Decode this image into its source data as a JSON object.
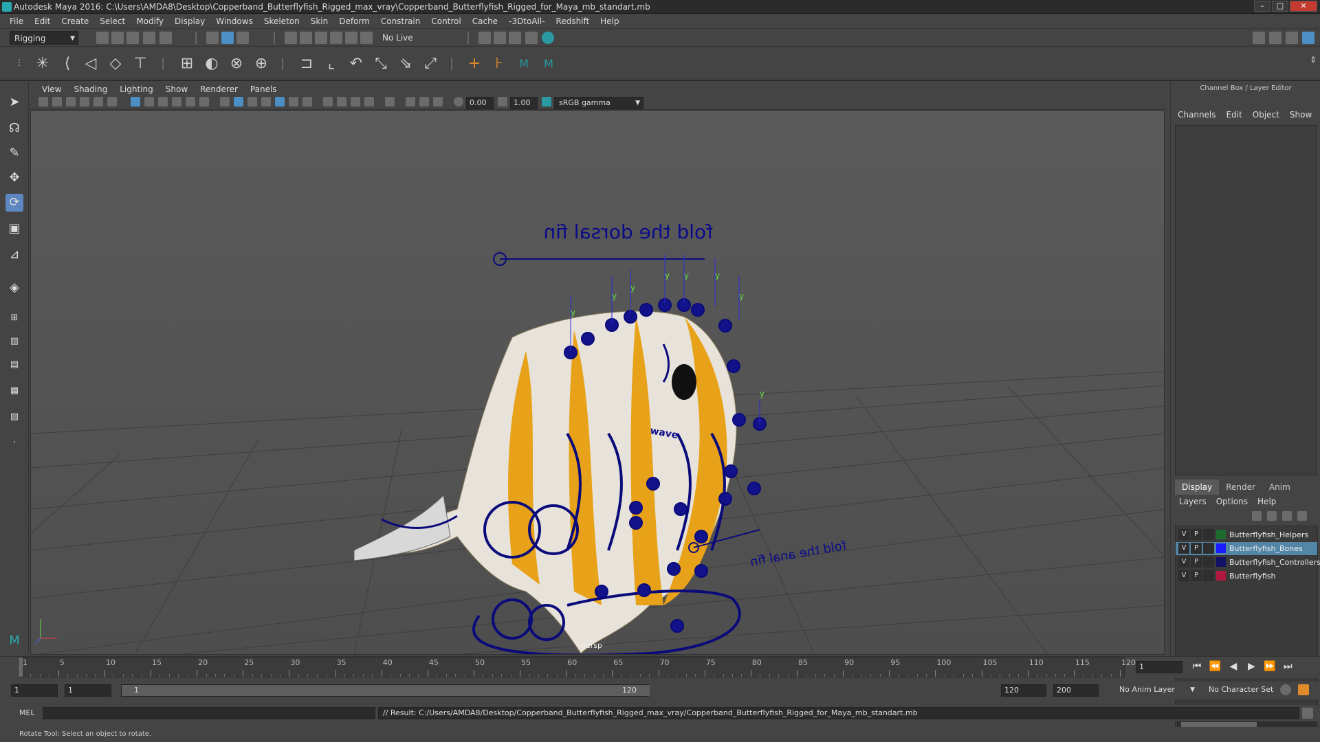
{
  "window": {
    "title": "Autodesk Maya 2016: C:\\Users\\AMDA8\\Desktop\\Copperband_Butterflyfish_Rigged_max_vray\\Copperband_Butterflyfish_Rigged_for_Maya_mb_standart.mb",
    "minimize": "–",
    "restore": "□",
    "close": "✕"
  },
  "menubar": {
    "items": [
      "File",
      "Edit",
      "Create",
      "Select",
      "Modify",
      "Display",
      "Windows",
      "Skeleton",
      "Skin",
      "Deform",
      "Constrain",
      "Control",
      "Cache",
      "-3DtoAll-",
      "Redshift",
      "Help"
    ]
  },
  "statusline": {
    "mode": "Rigging",
    "live_surface": "No Live Surface"
  },
  "panel": {
    "menu": [
      "View",
      "Shading",
      "Lighting",
      "Show",
      "Renderer",
      "Panels"
    ],
    "exposure": "0.00",
    "gamma": "1.00",
    "colorspace": "sRGB gamma"
  },
  "viewport": {
    "annotation_top": "fold the dorsal fin",
    "annotation_bottom": "fold the anal fin",
    "camera_label": "persp",
    "marker_y": "y",
    "controller_word": "wave"
  },
  "channel_box": {
    "title": "Channel Box / Layer Editor",
    "menu": [
      "Channels",
      "Edit",
      "Object",
      "Show"
    ]
  },
  "layer_editor": {
    "tabs": [
      "Display",
      "Render",
      "Anim"
    ],
    "menu": [
      "Layers",
      "Options",
      "Help"
    ],
    "layers": [
      {
        "v": "V",
        "p": "P",
        "name": "Butterflyfish_Helpers",
        "color": "#1e6b2e",
        "selected": false
      },
      {
        "v": "V",
        "p": "P",
        "name": "Butterflyfish_Bones",
        "color": "#1a1aff",
        "selected": true
      },
      {
        "v": "V",
        "p": "P",
        "name": "Butterflyfish_Controllers",
        "color": "#121266",
        "selected": false
      },
      {
        "v": "V",
        "p": "P",
        "name": "Butterflyfish",
        "color": "#b0183e",
        "selected": false
      }
    ]
  },
  "timeline": {
    "labels": [
      "1",
      "5",
      "10",
      "15",
      "20",
      "25",
      "30",
      "35",
      "40",
      "45",
      "50",
      "55",
      "60",
      "65",
      "70",
      "75",
      "80",
      "85",
      "90",
      "95",
      "100",
      "105",
      "110",
      "115",
      "120"
    ],
    "current_frame": "1"
  },
  "range": {
    "start": "1",
    "playback_start": "1",
    "slider_start": "1",
    "slider_end": "120",
    "playback_end": "120",
    "end": "200",
    "anim_layer": "No Anim Layer",
    "character_set": "No Character Set"
  },
  "command_line": {
    "label": "MEL",
    "result": "// Result: C:/Users/AMDA8/Desktop/Copperband_Butterflyfish_Rigged_max_vray/Copperband_Butterflyfish_Rigged_for_Maya_mb_standart.mb"
  },
  "help_line": "Rotate Tool: Select an object to rotate.",
  "playback_icons": [
    "⏮",
    "⏪",
    "◀",
    "▶",
    "⏩",
    "⏭"
  ]
}
